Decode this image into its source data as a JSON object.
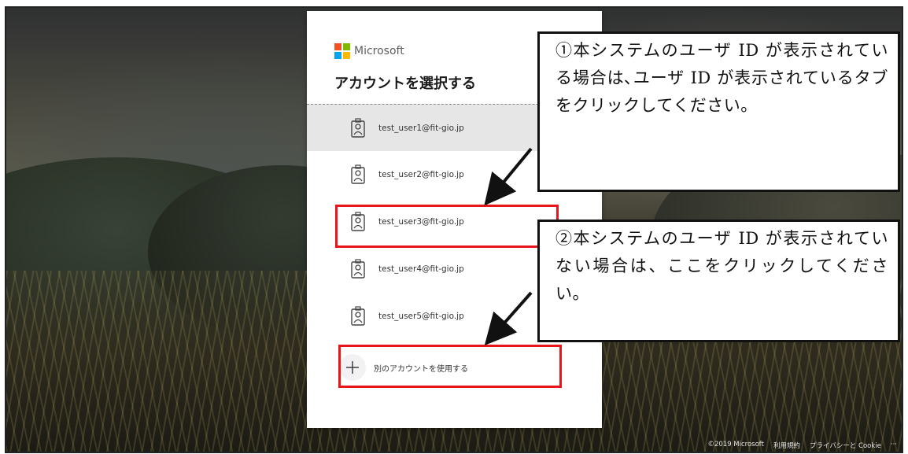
{
  "brand": {
    "name": "Microsoft",
    "logo_colors": [
      "#f25022",
      "#7fba00",
      "#00a4ef",
      "#ffb900"
    ]
  },
  "dialog": {
    "title": "アカウントを選択する",
    "accounts": [
      {
        "email": "test_user1@fit-gio.jp"
      },
      {
        "email": "test_user2@fit-gio.jp"
      },
      {
        "email": "test_user3@fit-gio.jp"
      },
      {
        "email": "test_user4@fit-gio.jp"
      },
      {
        "email": "test_user5@fit-gio.jp"
      }
    ],
    "use_another_label": "別のアカウントを使用する"
  },
  "callouts": {
    "note1": "①本システムのユーザ ID が表示されている場合は､ユーザ ID が表示されているタブをクリックしてください。",
    "note2": "②本システムのユーザ ID が表示されていない場合は、ここをクリックしてください。"
  },
  "footer": {
    "copyright": "©2019 Microsoft",
    "terms": "利用規約",
    "privacy": "プライバシーと Cookie",
    "more": "···"
  },
  "colors": {
    "highlight": "#e8151b",
    "panel_bg": "#ffffff",
    "selected_tile_bg": "#e6e6e6"
  }
}
